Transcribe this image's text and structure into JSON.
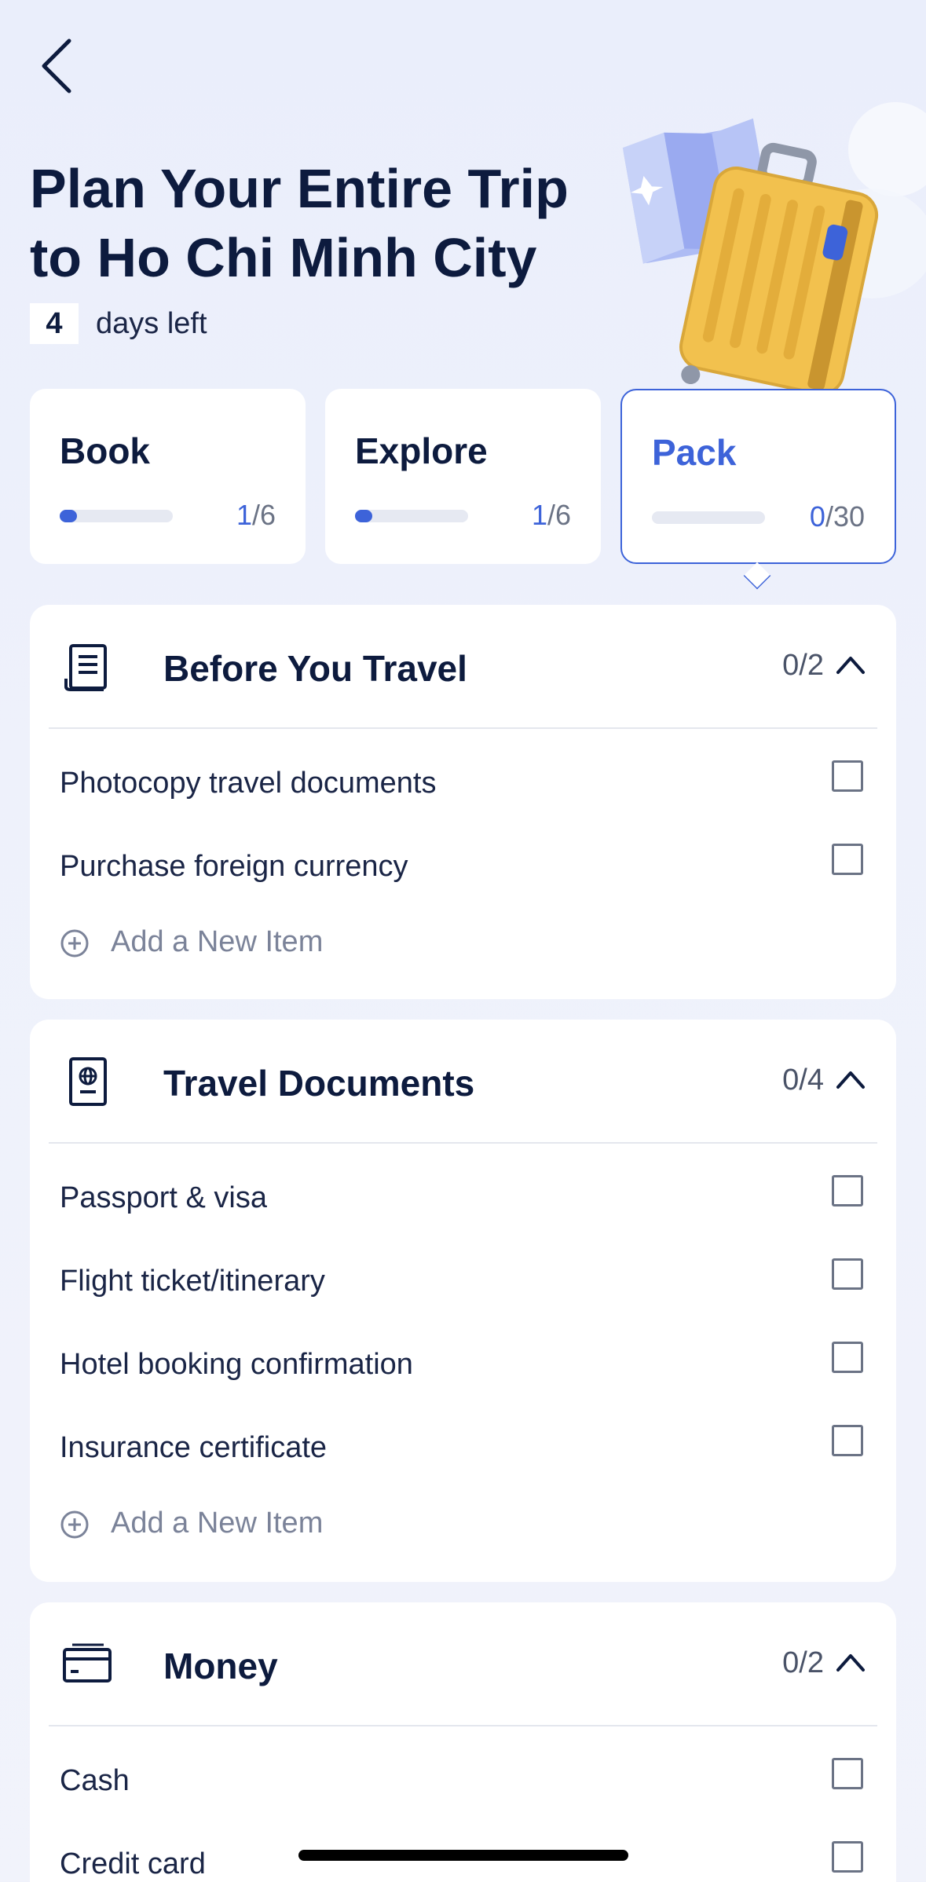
{
  "header": {
    "title_line1": "Plan Your Entire Trip",
    "title_line2": "to Ho Chi Minh City",
    "days_count": "4",
    "days_label": "days left"
  },
  "tabs": [
    {
      "name": "Book",
      "done": "1",
      "total": "/6",
      "progress": 0.16,
      "active": false
    },
    {
      "name": "Explore",
      "done": "1",
      "total": "/6",
      "progress": 0.16,
      "active": false
    },
    {
      "name": "Pack",
      "done": "0",
      "total": "/30",
      "progress": 0,
      "active": true
    }
  ],
  "sections": [
    {
      "title": "Before You Travel",
      "icon": "document-list-icon",
      "count": "0/2",
      "items": [
        "Photocopy travel documents",
        "Purchase foreign currency"
      ],
      "add_label": "Add a New Item"
    },
    {
      "title": "Travel Documents",
      "icon": "passport-icon",
      "count": "0/4",
      "items": [
        "Passport & visa",
        "Flight ticket/itinerary",
        "Hotel booking confirmation",
        "Insurance certificate"
      ],
      "add_label": "Add a New Item"
    },
    {
      "title": "Money",
      "icon": "credit-card-icon",
      "count": "0/2",
      "items": [
        "Cash",
        "Credit card"
      ]
    }
  ],
  "colors": {
    "accent": "#3d63d9",
    "text": "#0d1b3e",
    "suitcase": "#f2c14e"
  }
}
